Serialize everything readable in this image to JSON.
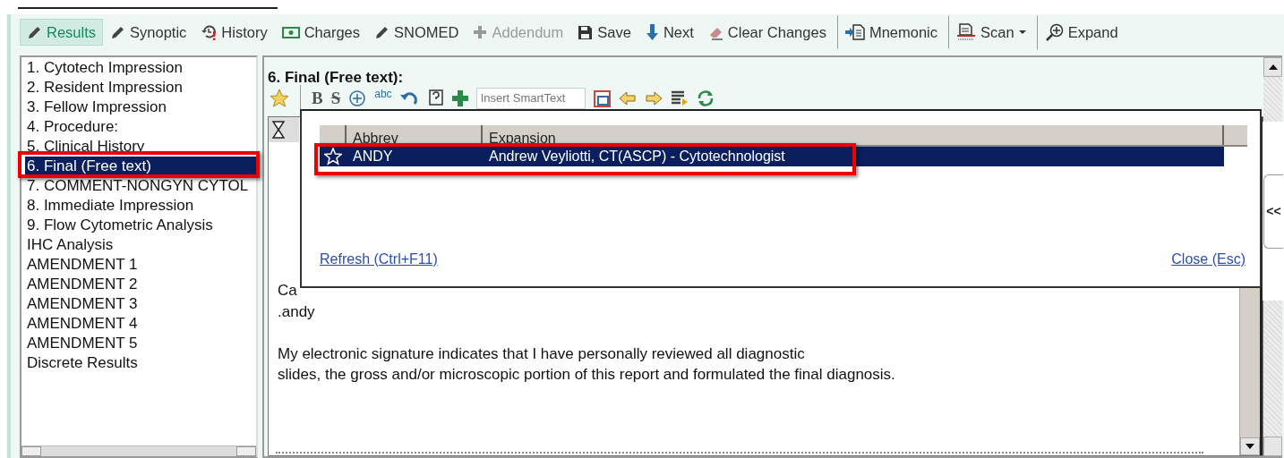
{
  "toolbar": [
    {
      "label": "Results",
      "selected": true,
      "disabled": false
    },
    {
      "label": "Synoptic",
      "selected": false,
      "disabled": false
    },
    {
      "label": "History",
      "selected": false,
      "disabled": false
    },
    {
      "label": "Charges",
      "selected": false,
      "disabled": false
    },
    {
      "label": "SNOMED",
      "selected": false,
      "disabled": false
    },
    {
      "label": "Addendum",
      "selected": false,
      "disabled": true
    },
    {
      "label": "Save",
      "selected": false,
      "disabled": false
    },
    {
      "label": "Next",
      "selected": false,
      "disabled": false
    },
    {
      "label": "Clear Changes",
      "selected": false,
      "disabled": false
    },
    {
      "label": "Mnemonic",
      "selected": false,
      "disabled": false,
      "separator_before": true
    },
    {
      "label": "Scan",
      "selected": false,
      "disabled": false,
      "separator_before": true,
      "dropdown": true
    },
    {
      "label": "Expand",
      "selected": false,
      "disabled": false,
      "separator_before": true
    }
  ],
  "sections": [
    {
      "label": "1. Cytotech Impression",
      "selected": false
    },
    {
      "label": "2. Resident Impression",
      "selected": false
    },
    {
      "label": "3. Fellow Impression",
      "selected": false
    },
    {
      "label": "4. Procedure:",
      "selected": false
    },
    {
      "label": "5. Clinical History",
      "selected": false
    },
    {
      "label": "6. Final (Free text)",
      "selected": true,
      "highlighted": true
    },
    {
      "label": "7. COMMENT-NONGYN CYTOL",
      "selected": false
    },
    {
      "label": "8. Immediate Impression",
      "selected": false
    },
    {
      "label": "9. Flow Cytometric Analysis",
      "selected": false
    },
    {
      "label": "IHC Analysis",
      "selected": false
    },
    {
      "label": "AMENDMENT 1",
      "selected": false
    },
    {
      "label": "AMENDMENT 2",
      "selected": false
    },
    {
      "label": "AMENDMENT 3",
      "selected": false
    },
    {
      "label": "AMENDMENT 4",
      "selected": false
    },
    {
      "label": "AMENDMENT 5",
      "selected": false
    },
    {
      "label": "Discrete Results",
      "selected": false
    }
  ],
  "editor": {
    "title": "6. Final (Free text):",
    "tools": {
      "bold": "B",
      "strike": "S",
      "spell": "abc",
      "smarttext_placeholder": "Insert SmartText"
    },
    "paragraphs": [
      [
        "Ca",
        ".andy"
      ],
      [
        "My electronic signature indicates that I have personally reviewed all diagnostic",
        "slides, the gross and/or microscopic portion of this report and formulated the final diagnosis."
      ]
    ]
  },
  "popup": {
    "columns": [
      "Abbrev",
      "Expansion"
    ],
    "rows": [
      {
        "abbrev": "ANDY",
        "expansion": "Andrew Veyliotti, CT(ASCP) - Cytotechnologist",
        "selected": true,
        "highlighted": true
      }
    ],
    "refresh_link": "Refresh (Ctrl+F11)",
    "close_link": "Close (Esc)",
    "side_tab": "<<"
  }
}
